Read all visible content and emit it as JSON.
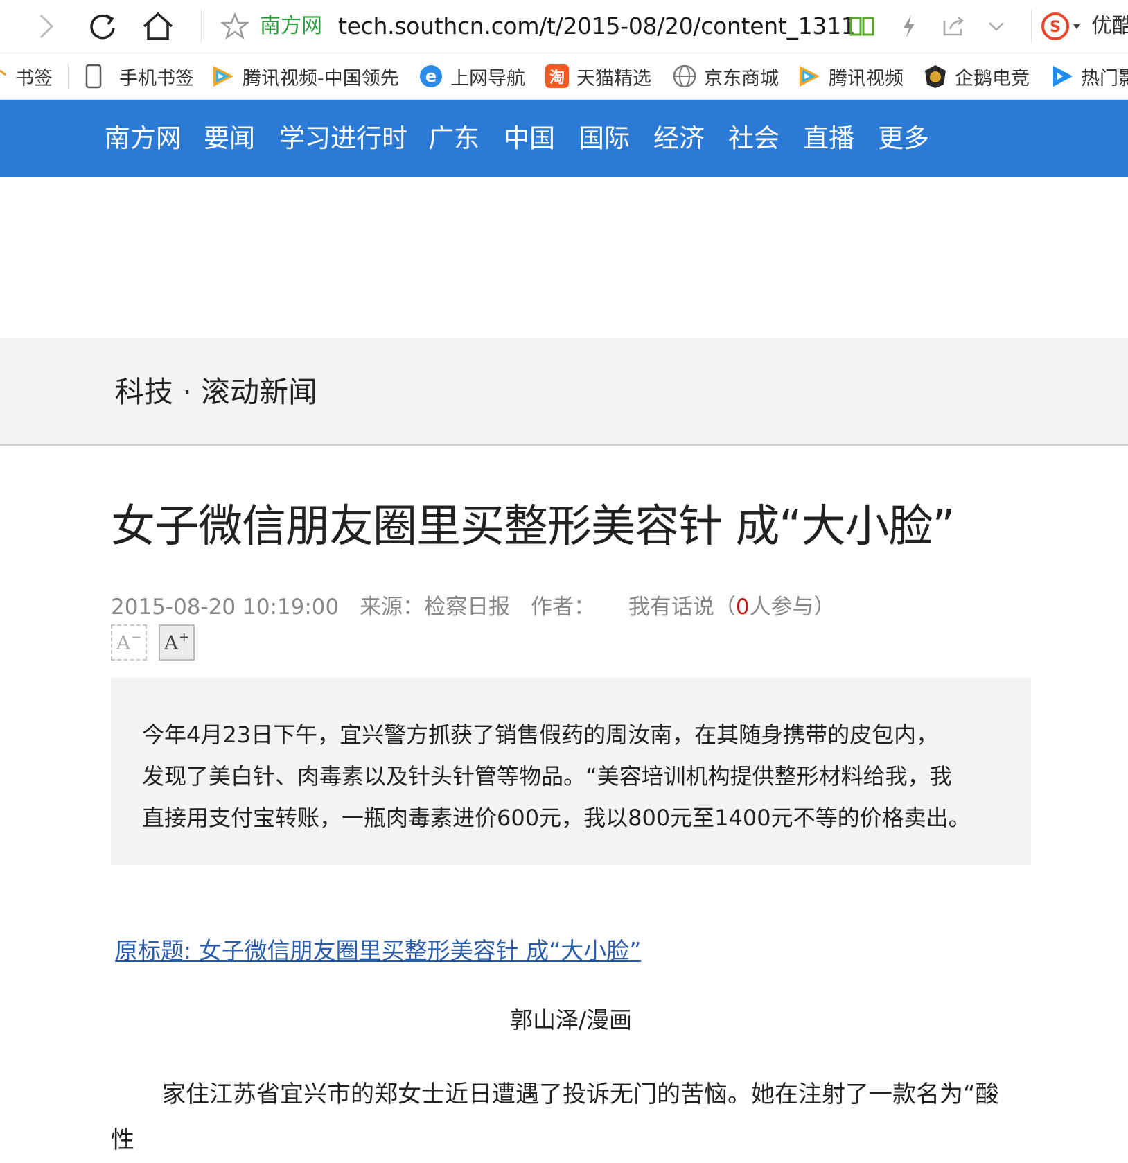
{
  "browser": {
    "site_name": "南方网",
    "url": "tech.southcn.com/t/2015-08/20/content_1311",
    "user_name": "优酷"
  },
  "bookmarks": [
    {
      "label": "书签",
      "icon": "bookmark-icon"
    },
    {
      "label": "手机书签",
      "icon": "phone-icon"
    },
    {
      "label": "腾讯视频-中国领先",
      "icon": "tencent-video-icon"
    },
    {
      "label": "上网导航",
      "icon": "ie-icon"
    },
    {
      "label": "天猫精选",
      "icon": "taobao-icon"
    },
    {
      "label": "京东商城",
      "icon": "globe-icon"
    },
    {
      "label": "腾讯视频",
      "icon": "tencent-video-icon"
    },
    {
      "label": "企鹅电竞",
      "icon": "esports-icon"
    },
    {
      "label": "热门影",
      "icon": "video-icon"
    }
  ],
  "site_nav": [
    "南方网",
    "要闻",
    "学习进行时",
    "广东",
    "中国",
    "国际",
    "经济",
    "社会",
    "直播",
    "更多"
  ],
  "section": {
    "title": "科技 · 滚动新闻"
  },
  "article": {
    "title": "女子微信朋友圈里买整形美容针 成“大小脸”",
    "date": "2015-08-20 10:19:00",
    "source": "来源：检察日报",
    "author": "作者：",
    "comment_prefix": "我有话说（",
    "comment_count": "0",
    "comment_suffix": "人参与）",
    "font_decrease": "A",
    "font_increase": "A",
    "summary_lines": [
      "今年4月23日下午，宜兴警方抓获了销售假药的周汝南，在其随身携带的皮包内，",
      "发现了美白针、肉毒素以及针头针管等物品。“美容培训机构提供整形材料给我，我",
      "直接用支付宝转账，一瓶肉毒素进价600元，我以800元至1400元不等的价格卖出。"
    ],
    "original_title_link": "原标题: 女子微信朋友圈里买整形美容针 成“大小脸”",
    "image_caption": "郭山泽/漫画",
    "body_paragraph": "家住江苏省宜兴市的郑女士近日遭遇了投诉无门的苦恼。她在注射了一款名为“酸性"
  },
  "colors": {
    "nav_bg": "#2a7ad6",
    "site_name_green": "#2e9b3c",
    "link_blue": "#2a5caa",
    "count_red": "#c11c1c"
  }
}
